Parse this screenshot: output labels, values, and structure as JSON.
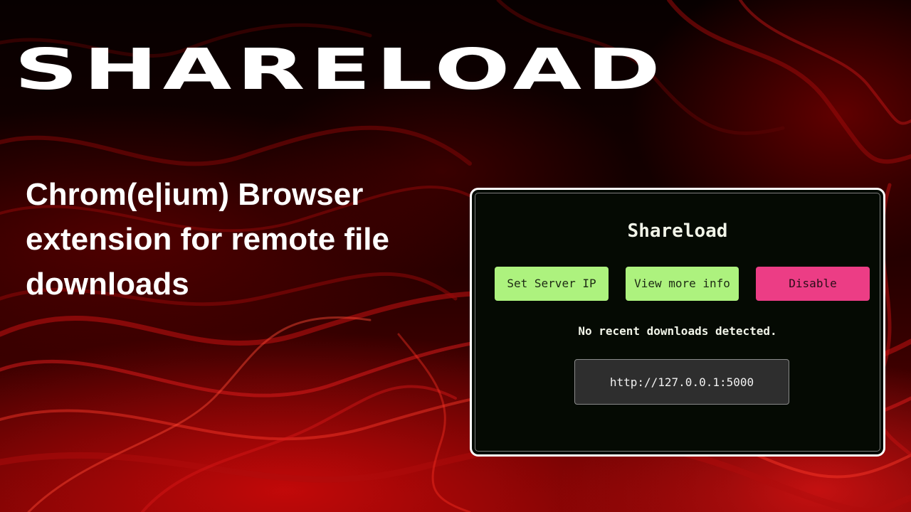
{
  "banner": {
    "title": "SHARELOAD",
    "subtitle": "Chrom(e|ium) Browser extension for remote file downloads"
  },
  "popup": {
    "title": "Shareload",
    "buttons": {
      "set_server_ip": "Set Server IP",
      "view_more_info": "View more info",
      "disable": "Disable"
    },
    "status_text": "No recent downloads detected.",
    "server_url": "http://127.0.0.1:5000"
  },
  "colors": {
    "background": "#0b0000",
    "background_accent": "#d01010",
    "popup_background": "#050a03",
    "button_green": "#adf27e",
    "button_pink": "#ec3d85",
    "url_box": "#2e2e2e"
  }
}
